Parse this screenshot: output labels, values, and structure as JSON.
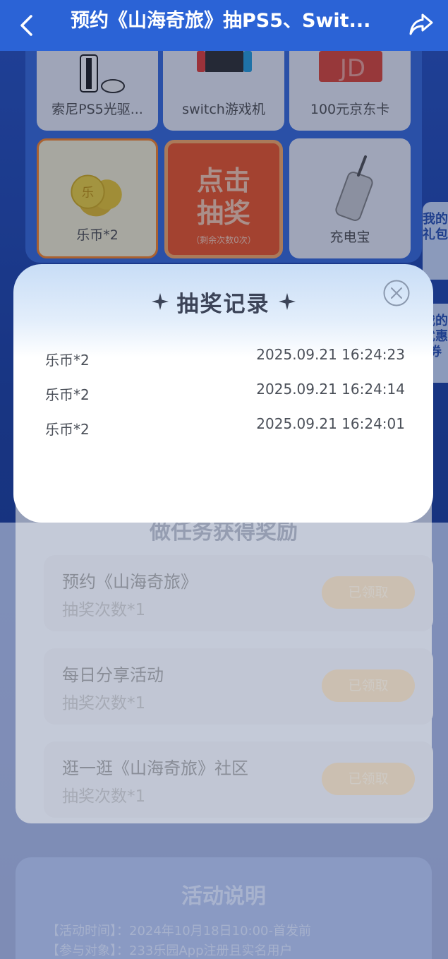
{
  "header": {
    "title": "预约《山海奇旅》抽PS5、Swit..."
  },
  "prize_grid": {
    "items": [
      {
        "label": "索尼PS5光驱..."
      },
      {
        "label": "switch游戏机"
      },
      {
        "label": "100元京东卡"
      },
      {
        "label": "乐币*2"
      },
      {
        "label": "充电宝"
      }
    ],
    "draw_button": {
      "line1": "点击",
      "line2": "抽奖",
      "remaining": "（剩余次数0次）"
    }
  },
  "side_tabs": {
    "gift": "我的礼包",
    "coupon": "我的优惠券"
  },
  "modal": {
    "title": "抽奖记录",
    "records": [
      {
        "prize": "乐币*2",
        "time": "2025.09.21 16:24:23"
      },
      {
        "prize": "乐币*2",
        "time": "2025.09.21 16:24:14"
      },
      {
        "prize": "乐币*2",
        "time": "2025.09.21 16:24:01"
      }
    ]
  },
  "tasks": {
    "title": "做任务获得奖励",
    "items": [
      {
        "name": "预约《山海奇旅》",
        "sub": "抽奖次数*1",
        "button": "已领取"
      },
      {
        "name": "每日分享活动",
        "sub": "抽奖次数*1",
        "button": "已领取"
      },
      {
        "name": "逛一逛《山海奇旅》社区",
        "sub": "抽奖次数*1",
        "button": "已领取"
      }
    ]
  },
  "description": {
    "title": "活动说明",
    "lines": [
      "【活动时间】：2024年10月18日10:00-首发前",
      "【参与对象】：233乐园App注册且实名用户"
    ]
  },
  "colors": {
    "header_bg": "#2b63d6",
    "draw_button": "#f45a2a",
    "claimed_button": "#f0c98f"
  }
}
